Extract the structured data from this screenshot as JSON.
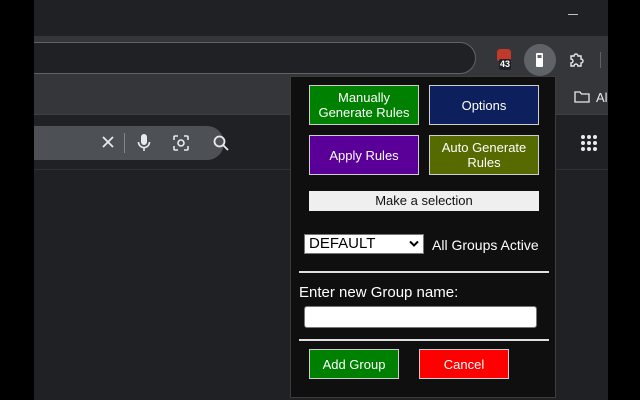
{
  "browser": {
    "extensions": {
      "badge_count": "43",
      "bookmark_folder_label": "Al"
    },
    "icons": {
      "minimize": "minimize-icon",
      "extension_badge": "extension-badge-icon",
      "active_extension": "fuel-pump-icon",
      "extensions_menu": "puzzle-icon",
      "bookmark_folder": "folder-icon",
      "search_close": "close-icon",
      "voice_search": "microphone-icon",
      "image_search": "lens-icon",
      "search": "search-icon",
      "apps": "apps-grid-icon"
    }
  },
  "popup": {
    "buttons": {
      "manual": "Manually Generate Rules",
      "options": "Options",
      "apply": "Apply Rules",
      "auto": "Auto Generate Rules",
      "add": "Add Group",
      "cancel": "Cancel"
    },
    "selection_bar": "Make a selection",
    "group_select": {
      "selected": "DEFAULT"
    },
    "groups_status": "All Groups Active",
    "new_group_label": "Enter new Group name:",
    "new_group_input": {
      "value": "",
      "placeholder": ""
    },
    "colors": {
      "green": "#008000",
      "navy": "#0d1f5c",
      "purple": "#5a0099",
      "olive": "#556b00",
      "red": "#ff0000"
    }
  }
}
